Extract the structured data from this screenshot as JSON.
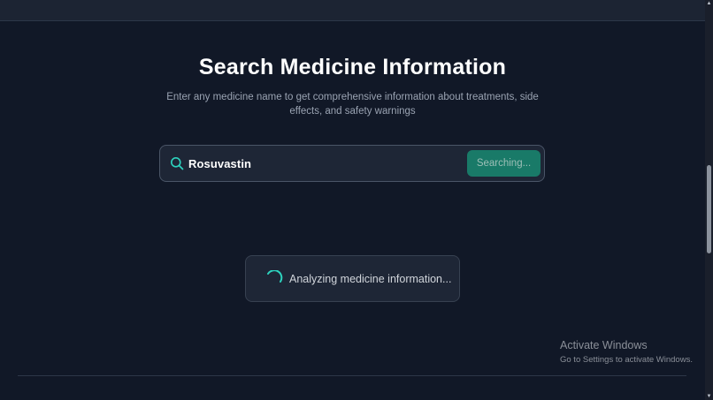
{
  "hero": {
    "title": "Search Medicine Information",
    "subtitle": "Enter any medicine name to get comprehensive information about treatments, side effects, and safety warnings"
  },
  "search": {
    "value": "Rosuvastin",
    "button_label": "Searching...",
    "icon": "search-icon",
    "accent": "#2dd4bf",
    "button_color": "#197a68"
  },
  "loading": {
    "text": "Analyzing medicine information...",
    "icon": "spinner-icon"
  },
  "watermark": {
    "title": "Activate Windows",
    "subtitle": "Go to Settings to activate Windows."
  },
  "colors": {
    "background": "#111827",
    "card": "#1e2636",
    "text_muted": "#9aa3b2"
  }
}
